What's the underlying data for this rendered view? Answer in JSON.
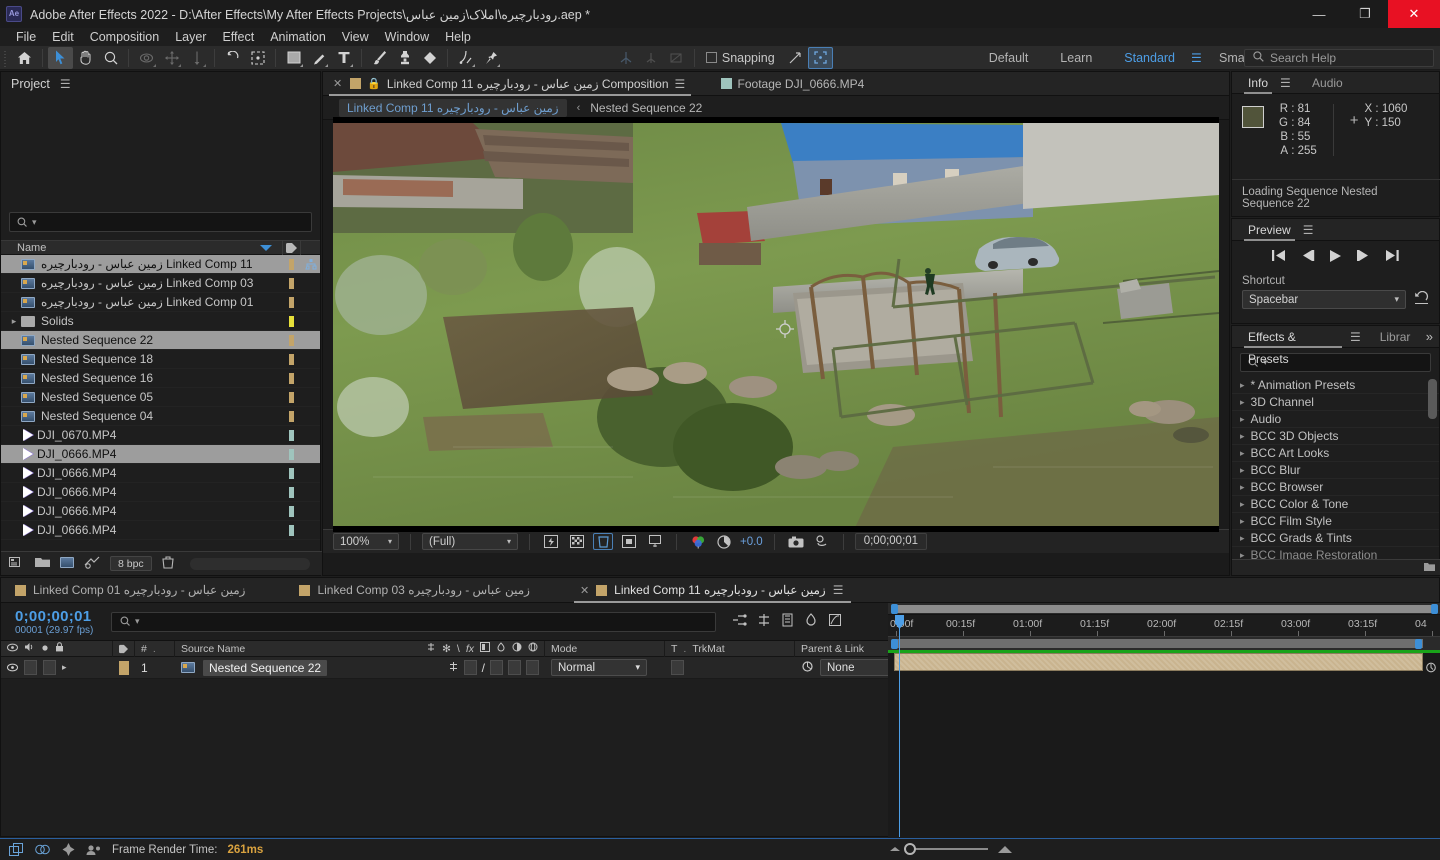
{
  "window": {
    "title": "Adobe After Effects 2022 - D:\\After Effects\\My After Effects Projects\\رودبارچیره\\املاک\\زمین عباس.aep *",
    "logo": "Ae",
    "minimize": "—",
    "maximize": "❐",
    "close": "✕"
  },
  "menubar": {
    "items": [
      "File",
      "Edit",
      "Composition",
      "Layer",
      "Effect",
      "Animation",
      "View",
      "Window",
      "Help"
    ]
  },
  "toolbar": {
    "tools": [
      {
        "name": "home-icon",
        "glyph": "home"
      },
      {
        "name": "selection-tool",
        "glyph": "arrow"
      },
      {
        "name": "hand-tool",
        "glyph": "hand"
      },
      {
        "name": "zoom-tool",
        "glyph": "magnifier"
      },
      {
        "name": "orbit-tool",
        "glyph": "orbit"
      },
      {
        "name": "pan-behind-tool",
        "glyph": "pan"
      },
      {
        "name": "push-tool",
        "glyph": "push"
      },
      {
        "name": "rotation-tool",
        "glyph": "rotate"
      },
      {
        "name": "roto-brush-tool",
        "glyph": "roto"
      },
      {
        "name": "shape-tool",
        "glyph": "rect"
      },
      {
        "name": "pen-tool",
        "glyph": "pen"
      },
      {
        "name": "type-tool",
        "glyph": "type"
      },
      {
        "name": "brush-tool",
        "glyph": "brush"
      },
      {
        "name": "clone-stamp-tool",
        "glyph": "stamp"
      },
      {
        "name": "eraser-tool",
        "glyph": "eraser"
      },
      {
        "name": "puppet-pin-tool",
        "glyph": "puppet"
      },
      {
        "name": "puppet-starch-tool",
        "glyph": "starch"
      }
    ],
    "snapping_label": "Snapping",
    "workspaces": [
      "Default",
      "Learn",
      "Standard",
      "Small Screen"
    ],
    "workspace_selected": "Standard",
    "overflow": "»"
  },
  "search_help": {
    "placeholder": "Search Help"
  },
  "project": {
    "title": "Project",
    "search_placeholder": "",
    "columns": {
      "name": "Name"
    },
    "items": [
      {
        "label": "زمین عباس - رودبارچیره Linked Comp 11",
        "type": "comp",
        "selected": true,
        "swatch": "comp"
      },
      {
        "label": "زمین عباس - رودبارچیره Linked Comp 03",
        "type": "comp",
        "selected": false,
        "swatch": "comp"
      },
      {
        "label": "زمین عباس - رودبارچیره Linked Comp 01",
        "type": "comp",
        "selected": false,
        "swatch": "comp"
      },
      {
        "label": "Solids",
        "type": "folder",
        "selected": false,
        "swatch": "yellow"
      },
      {
        "label": "Nested Sequence 22",
        "type": "comp",
        "selected": true,
        "swatch": "comp"
      },
      {
        "label": "Nested Sequence 18",
        "type": "comp",
        "selected": false,
        "swatch": "comp"
      },
      {
        "label": "Nested Sequence 16",
        "type": "comp",
        "selected": false,
        "swatch": "comp"
      },
      {
        "label": "Nested Sequence 05",
        "type": "comp",
        "selected": false,
        "swatch": "comp"
      },
      {
        "label": "Nested Sequence 04",
        "type": "comp",
        "selected": false,
        "swatch": "comp"
      },
      {
        "label": "DJI_0670.MP4",
        "type": "video",
        "selected": false,
        "swatch": "video"
      },
      {
        "label": "DJI_0666.MP4",
        "type": "video",
        "selected": true,
        "swatch": "video"
      },
      {
        "label": "DJI_0666.MP4",
        "type": "video",
        "selected": false,
        "swatch": "video"
      },
      {
        "label": "DJI_0666.MP4",
        "type": "video",
        "selected": false,
        "swatch": "video"
      },
      {
        "label": "DJI_0666.MP4",
        "type": "video",
        "selected": false,
        "swatch": "video"
      },
      {
        "label": "DJI_0666.MP4",
        "type": "video",
        "selected": false,
        "swatch": "video"
      }
    ],
    "footer": {
      "bit_depth": "8 bpc"
    }
  },
  "composition": {
    "tabs": [
      {
        "label": "Composition زمین عباس - رودبارچیره Linked Comp 11",
        "active": true,
        "closable": true,
        "locked": true
      },
      {
        "label": "Footage DJI_0666.MP4",
        "active": false,
        "closable": false,
        "locked": false
      }
    ],
    "breadcrumb": {
      "current": "زمین عباس - رودبارچیره Linked Comp 11",
      "arrow": "‹",
      "next": "Nested Sequence 22"
    },
    "footer": {
      "zoom": "100%",
      "resolution": "(Full)",
      "exposure": "+0.0",
      "timecode": "0;00;00;01"
    }
  },
  "info": {
    "tabs": [
      "Info",
      "Audio"
    ],
    "active_tab": "Info",
    "color": "#51543a",
    "channels": [
      {
        "k": "R",
        "v": "81"
      },
      {
        "k": "G",
        "v": "84"
      },
      {
        "k": "B",
        "v": "55"
      },
      {
        "k": "A",
        "v": "255"
      }
    ],
    "coords": [
      {
        "k": "X",
        "v": "1060"
      },
      {
        "k": "Y",
        "v": "150"
      }
    ],
    "status": "Loading Sequence Nested Sequence 22"
  },
  "preview": {
    "title": "Preview",
    "shortcut_label": "Shortcut",
    "shortcut_value": "Spacebar",
    "transport": [
      "first-frame",
      "prev-frame",
      "play",
      "next-frame",
      "last-frame"
    ]
  },
  "effects": {
    "tabs": [
      "Effects & Presets",
      "Librar"
    ],
    "active_tab": "Effects & Presets",
    "search_placeholder": "",
    "items": [
      "* Animation Presets",
      "3D Channel",
      "Audio",
      "BCC 3D Objects",
      "BCC Art Looks",
      "BCC Blur",
      "BCC Browser",
      "BCC Color & Tone",
      "BCC Film Style",
      "BCC Grads & Tints",
      "BCC Image Restoration"
    ]
  },
  "timeline": {
    "tabs": [
      {
        "label": "زمین عباس - رودبارچیره Linked Comp 01",
        "active": false,
        "closable": false
      },
      {
        "label": "زمین عباس - رودبارچیره Linked Comp 03",
        "active": false,
        "closable": false
      },
      {
        "label": "زمین عباس - رودبارچیره Linked Comp 11",
        "active": true,
        "closable": true
      }
    ],
    "timecode": "0;00;00;01",
    "frame_info": "00001 (29.97 fps)",
    "search_placeholder": "",
    "columns": {
      "source_name": "Source Name",
      "index": "#",
      "mode": "Mode",
      "t": "T",
      "trkmat": "TrkMat",
      "parent_link": "Parent & Link"
    },
    "layers": [
      {
        "index": "1",
        "name": "Nested Sequence 22",
        "mode": "Normal",
        "trkmat": "",
        "parent": "None"
      }
    ],
    "ruler_ticks": [
      "0:00f",
      "00:15f",
      "01:00f",
      "01:15f",
      "02:00f",
      "02:15f",
      "03:00f",
      "03:15f",
      "04"
    ]
  },
  "statusbar": {
    "label": "Frame Render Time:",
    "value": "261ms"
  }
}
